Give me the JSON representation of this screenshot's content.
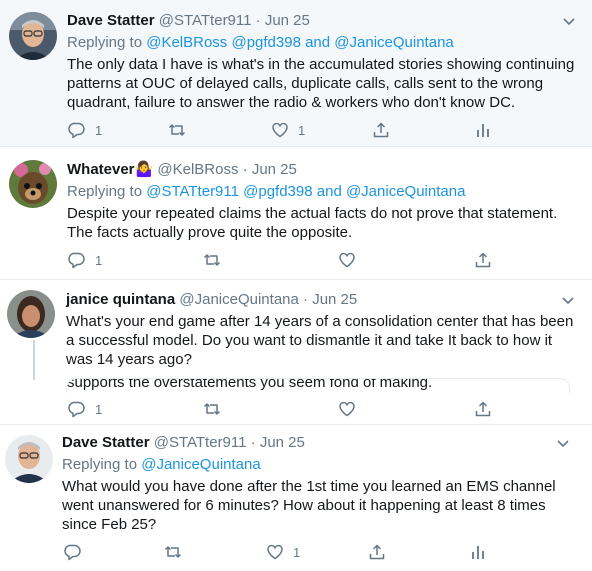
{
  "tweets": [
    {
      "name": "Dave Statter",
      "handle": "@STATter911",
      "sep": "·",
      "date": "Jun 25",
      "replying_prefix": "Replying to",
      "replying_to": "@KelBRoss @pgfd398 and @JaniceQuintana",
      "text": "The only data I have is what's in the accumulated stories showing continuing patterns at OUC of delayed calls, duplicate calls, calls sent to the wrong quadrant, failure to answer the radio & workers who don't know DC.",
      "reply_count": "1",
      "retweet_count": "",
      "like_count": "1"
    },
    {
      "name": "Whatever",
      "name_emoji": "🤷‍♀️",
      "handle": "@KelBRoss",
      "sep": "·",
      "date": "Jun 25",
      "replying_prefix": "Replying to",
      "replying_to": "@STATter911 @pgfd398 and @JaniceQuintana",
      "text": "Despite your repeated claims the actual facts do not prove that statement. The facts actually prove quite the opposite.",
      "reply_count": "1",
      "retweet_count": "",
      "like_count": ""
    },
    {
      "name": "janice quintana",
      "handle": "@JaniceQuintana",
      "sep": "·",
      "date": "Jun 25",
      "text": "What's your end game after 14 years of a consolidation center that has been a successful model. Do you want to dismantle it and take It back to how it was 14 years ago?",
      "quote_peek": "supports the overstatements you seem fond of making.",
      "reply_count": "1",
      "retweet_count": "",
      "like_count": ""
    },
    {
      "name": "Dave Statter",
      "handle": "@STATter911",
      "sep": "·",
      "date": "Jun 25",
      "replying_prefix": "Replying to",
      "replying_to": "@JaniceQuintana",
      "text": "What would you have done after the 1st time you learned an EMS channel went unanswered for 6 minutes? How about it happening at least 8 times since Feb 25?",
      "reply_count": "",
      "retweet_count": "",
      "like_count": "1"
    }
  ],
  "colors": {
    "link": "#1b95e0",
    "muted": "#657786",
    "text": "#14171a",
    "highlight_bg": "#f5f8fa"
  }
}
